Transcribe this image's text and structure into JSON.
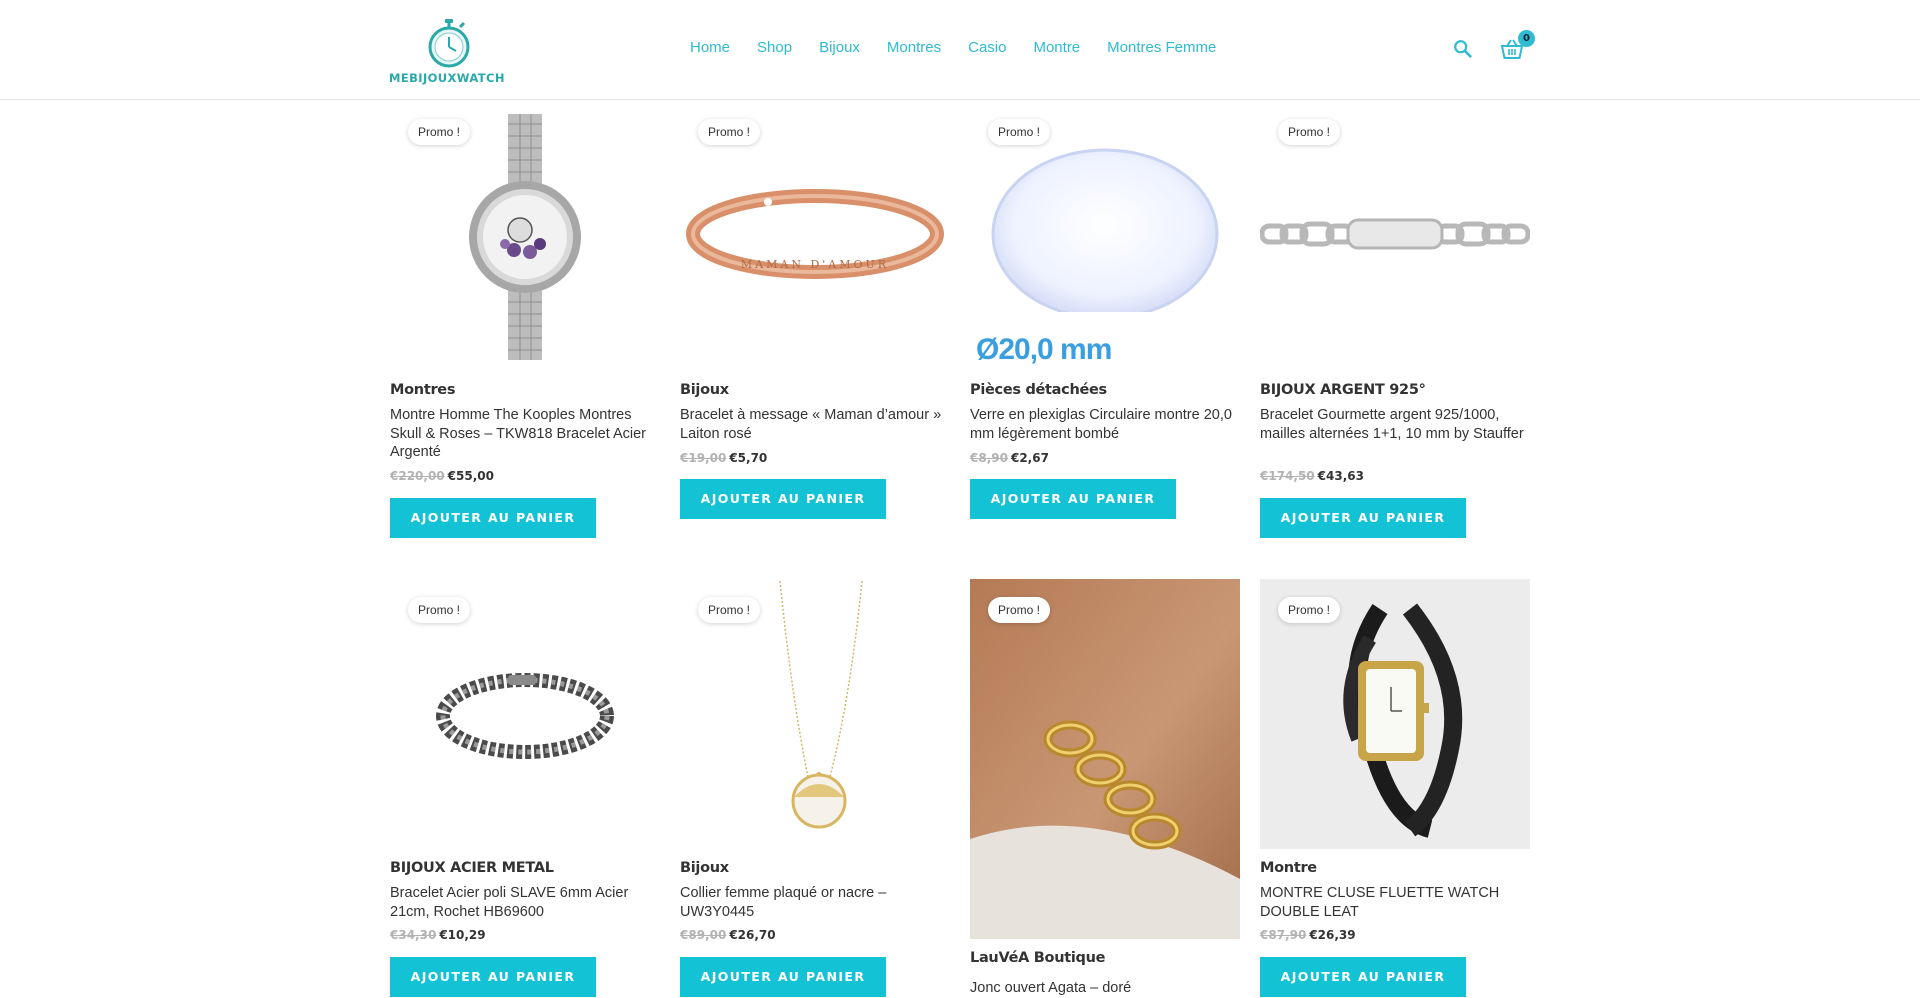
{
  "header": {
    "logo_text": "MEBIJOUXWATCH",
    "nav": [
      "Home",
      "Shop",
      "Bijoux",
      "Montres",
      "Casio",
      "Montre",
      "Montres Femme"
    ],
    "cart_count": "0"
  },
  "badge_label": "Promo !",
  "add_to_cart": "AJOUTER AU PANIER",
  "products": [
    {
      "category": "Montres",
      "title": "Montre Homme The Kooples Montres Skull & Roses – TKW818 Bracelet Acier Argenté",
      "old_price": "€220,00",
      "price": "€55,00"
    },
    {
      "category": "Bijoux",
      "title": "Bracelet à message « Maman d’amour » Laiton rosé",
      "old_price": "€19,00",
      "price": "€5,70"
    },
    {
      "category": "Pièces détachées",
      "title": "Verre en plexiglas Circulaire montre 20,0 mm légèrement bombé",
      "old_price": "€8,90",
      "price": "€2,67",
      "image_text": "Ø20,0 mm"
    },
    {
      "category": "BIJOUX ARGENT 925°",
      "title": "Bracelet Gourmette argent 925/1000, mailles alternées 1+1, 10 mm by Stauffer",
      "old_price": "€174,50",
      "price": "€43,63"
    },
    {
      "category": "BIJOUX ACIER METAL",
      "title": "Bracelet Acier poli SLAVE 6mm Acier 21cm, Rochet HB69600",
      "old_price": "€34,30",
      "price": "€10,29"
    },
    {
      "category": "Bijoux",
      "title": "Collier femme plaqué or nacre – UW3Y0445",
      "old_price": "€89,00",
      "price": "€26,70"
    },
    {
      "category": "LauVéA Boutique",
      "title": "Jonc ouvert Agata – doré",
      "old_price": "",
      "price": ""
    },
    {
      "category": "Montre",
      "title": "MONTRE CLUSE FLUETTE WATCH DOUBLE LEAT",
      "old_price": "€87,90",
      "price": "€26,39"
    }
  ]
}
